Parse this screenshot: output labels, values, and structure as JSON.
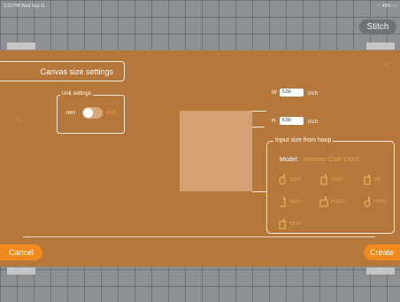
{
  "status_bar": {
    "time": "1:23 PM  Wed Sep 11",
    "battery": "46%"
  },
  "toolbar": {
    "stitch_label": "Stitch"
  },
  "dialog": {
    "title": "Canvas size settings",
    "unit_settings": {
      "legend": "Unit settings",
      "option_mm": "mm",
      "option_inch": "inch",
      "selected": "inch"
    },
    "width": {
      "label": "W",
      "value": "5.50",
      "unit": "inch"
    },
    "height": {
      "label": "H",
      "value": "6.50",
      "unit": "inch"
    },
    "hoop": {
      "legend": "Input size from hoop",
      "model_label": "Model:",
      "model_value": "Memory Craft 15000",
      "items": [
        "SQ14",
        "SQ23",
        "GR",
        "FA10",
        "ASQ22",
        "HH10",
        "RE18"
      ]
    },
    "cancel_label": "Cancel",
    "create_label": "Create"
  },
  "colors": {
    "accent": "#f08a1d",
    "dialog_bg": "#b6783a",
    "hoop_text": "#e9a555"
  }
}
